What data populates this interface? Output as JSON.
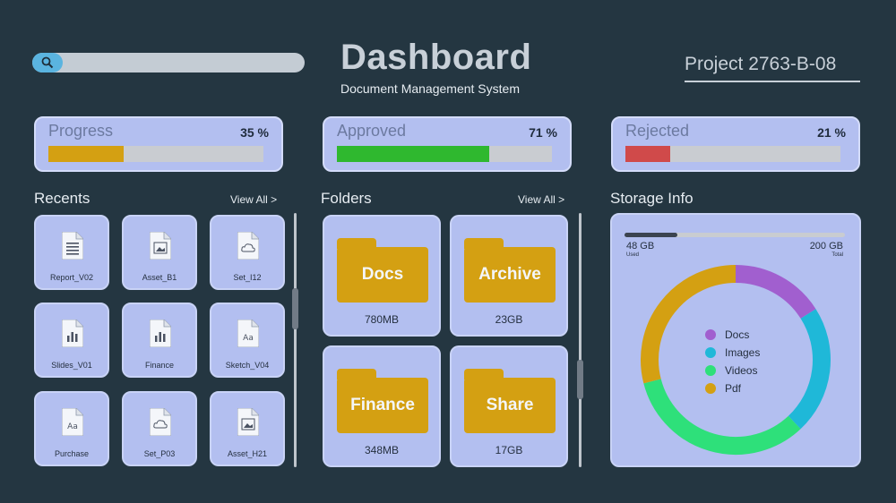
{
  "header": {
    "title": "Dashboard",
    "subtitle": "Document Management System",
    "project": "Project 2763-B-08"
  },
  "stats": [
    {
      "label": "Progress",
      "percent_text": "35 %",
      "value": 35,
      "color": "#d4a012"
    },
    {
      "label": "Approved",
      "percent_text": "71 %",
      "value": 71,
      "color": "#2fb82f"
    },
    {
      "label": "Rejected",
      "percent_text": "21 %",
      "value": 21,
      "color": "#d04a4a"
    }
  ],
  "recents": {
    "heading": "Recents",
    "view_all": "View All >",
    "items": [
      {
        "label": "Report_V02",
        "icon": "document-lines-icon"
      },
      {
        "label": "Asset_B1",
        "icon": "image-file-icon"
      },
      {
        "label": "Set_I12",
        "icon": "cloud-file-icon"
      },
      {
        "label": "Slides_V01",
        "icon": "chart-file-icon"
      },
      {
        "label": "Finance",
        "icon": "chart-file-icon"
      },
      {
        "label": "Sketch_V04",
        "icon": "font-file-icon"
      },
      {
        "label": "Purchase",
        "icon": "font-file-icon"
      },
      {
        "label": "Set_P03",
        "icon": "cloud-file-icon"
      },
      {
        "label": "Asset_H21",
        "icon": "image-file-icon"
      }
    ]
  },
  "folders": {
    "heading": "Folders",
    "view_all": "View All >",
    "items": [
      {
        "name": "Docs",
        "size": "780MB"
      },
      {
        "name": "Archive",
        "size": "23GB"
      },
      {
        "name": "Finance",
        "size": "348MB"
      },
      {
        "name": "Share",
        "size": "17GB"
      }
    ],
    "folder_color": "#d4a012"
  },
  "storage": {
    "heading": "Storage Info",
    "used": "48 GB",
    "used_caption": "Used",
    "total": "200 GB",
    "total_caption": "Total",
    "used_fraction": 0.24,
    "legend": [
      {
        "label": "Docs",
        "color": "#a15fcf",
        "share": 16
      },
      {
        "label": "Images",
        "color": "#1fb8d8",
        "share": 22
      },
      {
        "label": "Videos",
        "color": "#2ee07a",
        "share": 33
      },
      {
        "label": "Pdf",
        "color": "#d4a012",
        "share": 29
      }
    ]
  }
}
